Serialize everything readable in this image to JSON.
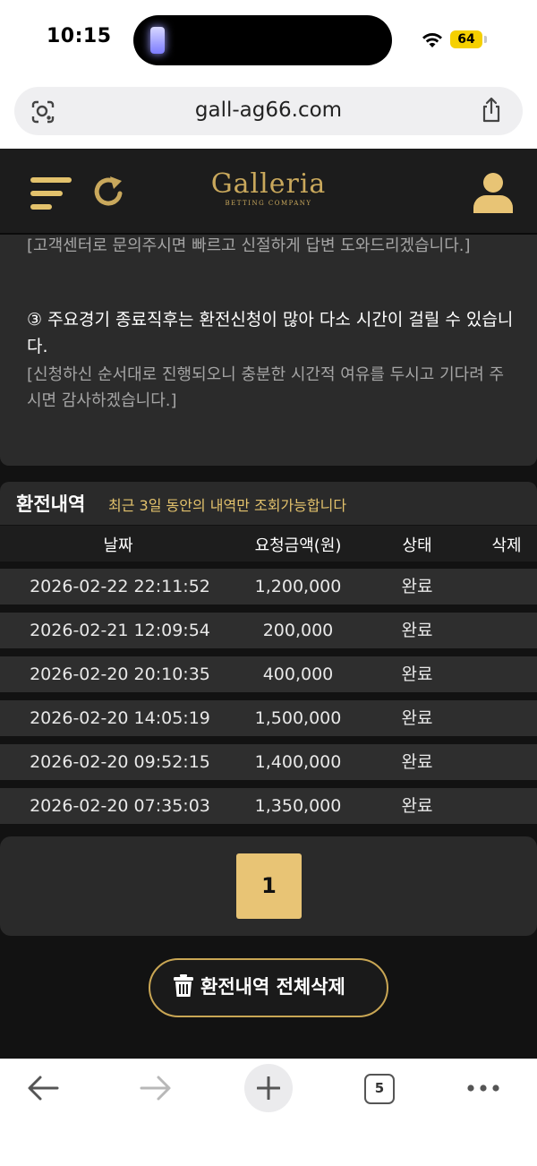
{
  "status_bar": {
    "time": "10:15",
    "battery": "64"
  },
  "browser": {
    "url": "gall-ag66.com",
    "open_tabs": "5"
  },
  "site": {
    "logo": "Galleria",
    "logo_sub": "BETTING COMPANY"
  },
  "notice": {
    "top_text": "[고객센터로 문의주시면 빠르고 신절하게 답변 도와드리겠습니다.]",
    "item3": "③ 주요경기 종료직후는 환전신청이 많아 다소 시간이 걸릴 수 있습니다.",
    "item3_sub": "[신청하신 순서대로 진행되오니 충분한 시간적 여유를 두시고 기다려 주시면 감사하겠습니다.]"
  },
  "history": {
    "title": "환전내역",
    "note": "최근 3일 동안의 내역만 조회가능합니다",
    "columns": {
      "date": "날짜",
      "amount": "요청금액(원)",
      "status": "상태",
      "delete": "삭제"
    },
    "rows": [
      {
        "date": "2026-02-22 22:11:52",
        "amount": "1,200,000",
        "status": "완료"
      },
      {
        "date": "2026-02-21 12:09:54",
        "amount": "200,000",
        "status": "완료"
      },
      {
        "date": "2026-02-20 20:10:35",
        "amount": "400,000",
        "status": "완료"
      },
      {
        "date": "2026-02-20 14:05:19",
        "amount": "1,500,000",
        "status": "완료"
      },
      {
        "date": "2026-02-20 09:52:15",
        "amount": "1,400,000",
        "status": "완료"
      },
      {
        "date": "2026-02-20 07:35:03",
        "amount": "1,350,000",
        "status": "완료"
      }
    ]
  },
  "pagination": {
    "current_page": "1"
  },
  "actions": {
    "delete_all_label": "환전내역 전체삭제"
  },
  "colors": {
    "accent_gold": "#e8c475",
    "logo_gold": "#c9a85c",
    "note_gold": "#e3c26c",
    "background": "#121212"
  }
}
